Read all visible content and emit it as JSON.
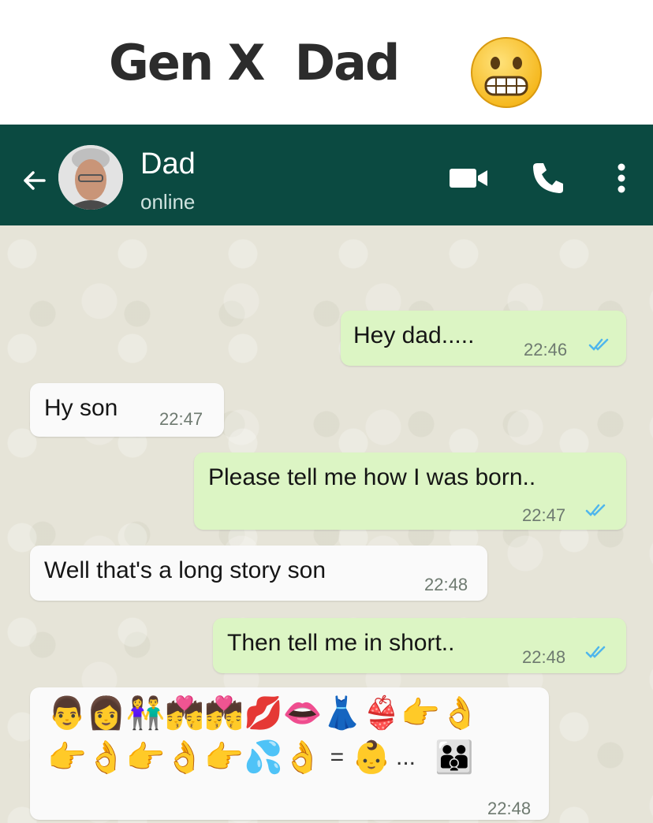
{
  "caption": {
    "text": "Gen X  Dad",
    "emoji": "grimacing-face"
  },
  "header": {
    "contact_name": "Dad",
    "status": "online",
    "icons": [
      "back-arrow-icon",
      "avatar",
      "video-call-icon",
      "phone-icon",
      "more-options-icon"
    ],
    "bg_color": "#0b4a41"
  },
  "messages": [
    {
      "direction": "out",
      "text": "Hey dad.....",
      "time": "22:46",
      "read": true
    },
    {
      "direction": "in",
      "text": "Hy son",
      "time": "22:47"
    },
    {
      "direction": "out",
      "text": "Please tell me how I was born..",
      "time": "22:47",
      "read": true
    },
    {
      "direction": "in",
      "text": "Well that's a long story son",
      "time": "22:48"
    },
    {
      "direction": "out",
      "text": "Then tell me in short..",
      "time": "22:48",
      "read": true
    },
    {
      "direction": "in",
      "emoji_line_1": [
        "man",
        "woman",
        "man-and-woman",
        "kiss",
        "kiss",
        "kiss-lips",
        "lips",
        "dress",
        "bikini",
        "pointing-hand",
        "ok-hand"
      ],
      "emoji_line_2": [
        "pointing-hand",
        "ok-hand",
        "pointing-hand",
        "ok-hand",
        "pointing-hand",
        "sweat-droplets",
        "ok-hand",
        "=",
        "baby",
        "...",
        "family"
      ],
      "emoji_text_1": "👨👩👫💏💏💋👄👗👙👉👌",
      "emoji_text_2": "👉👌👉👌👉💦👌",
      "equals": "=",
      "ellipsis": "...",
      "baby": "👶",
      "family": "👪",
      "time": "22:48"
    }
  ],
  "colors": {
    "outgoing_bubble": "#dcf5c4",
    "incoming_bubble": "#fafafa",
    "read_ticks": "#4fb6ec"
  }
}
